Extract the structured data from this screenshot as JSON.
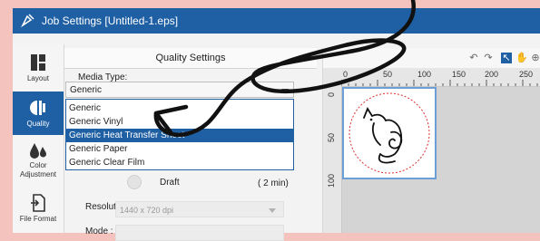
{
  "titlebar": {
    "title": "Job Settings [Untitled-1.eps]",
    "icon": "pen-tool-icon"
  },
  "nav": {
    "items": [
      {
        "label": "Layout",
        "icon": "layout-icon"
      },
      {
        "label": "Quality",
        "icon": "quality-icon",
        "active": true
      },
      {
        "label": "Color\nAdjustment",
        "icon": "droplets-icon"
      },
      {
        "label": "File Format",
        "icon": "file-format-icon"
      }
    ]
  },
  "quality": {
    "header": "Quality Settings",
    "media_label": "Media Type:",
    "media_value": "Generic",
    "options": [
      "Generic",
      "Generic Vinyl",
      "Generic Heat Transfer Sheet",
      "Generic Paper",
      "Generic Clear Film"
    ],
    "selected_index": 2,
    "draft_label": "Draft",
    "draft_time": "( 2 min)",
    "resolution_label": "Resolution :",
    "resolution_value": "1440 x 720 dpi",
    "mode_label": "Mode :"
  },
  "preview": {
    "ruler_h": [
      "0",
      "50",
      "100",
      "150",
      "200",
      "250"
    ],
    "ruler_v": [
      "0",
      "50",
      "100"
    ]
  },
  "colors": {
    "accent": "#1f5fa3",
    "background": "#f4c3be"
  }
}
